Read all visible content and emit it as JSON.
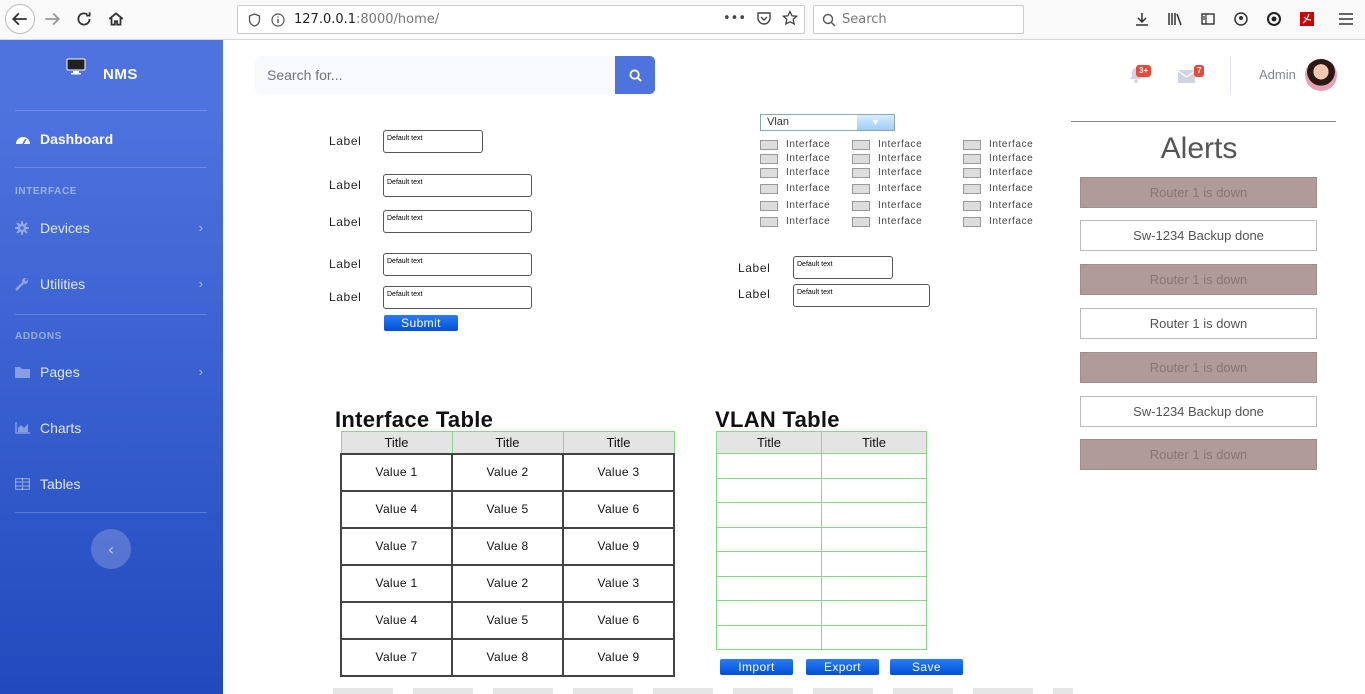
{
  "browser": {
    "url_host": "127.0.0.1",
    "url_rest": ":8000/home/",
    "url_more": "•••",
    "search_placeholder": "Search"
  },
  "sidebar": {
    "brand": "NMS",
    "dashboard": "Dashboard",
    "heading_interface": "INTERFACE",
    "devices": "Devices",
    "utilities": "Utilities",
    "heading_addons": "ADDONS",
    "pages": "Pages",
    "charts": "Charts",
    "tables": "Tables"
  },
  "topbar": {
    "search_placeholder": "Search for...",
    "alerts_count": "3+",
    "messages_count": "7",
    "user_name": "Admin"
  },
  "form_left": {
    "labels": [
      "Label",
      "Label",
      "Label",
      "Label",
      "Label"
    ],
    "values": [
      "Default text",
      "Default text",
      "Default text",
      "Default text",
      "Default text"
    ],
    "submit": "Submit"
  },
  "form_right": {
    "vlan_select": "Vlan",
    "interface_label": "Interface",
    "labels": [
      "Label",
      "Label"
    ],
    "values": [
      "Default text",
      "Default text"
    ]
  },
  "interface_table": {
    "title": "Interface Table",
    "headers": [
      "Title",
      "Title",
      "Title"
    ],
    "rows": [
      [
        "Value 1",
        "Value 2",
        "Value 3"
      ],
      [
        "Value 4",
        "Value 5",
        "Value 6"
      ],
      [
        "Value 7",
        "Value 8",
        "Value 9"
      ],
      [
        "Value 1",
        "Value 2",
        "Value 3"
      ],
      [
        "Value 4",
        "Value 5",
        "Value 6"
      ],
      [
        "Value 7",
        "Value 8",
        "Value 9"
      ]
    ]
  },
  "vlan_table": {
    "title": "VLAN Table",
    "headers": [
      "Title",
      "Title"
    ],
    "import": "Import",
    "export": "Export",
    "save": "Save"
  },
  "alerts": {
    "title": "Alerts",
    "items": [
      {
        "text": "Router 1 is down",
        "status": "down"
      },
      {
        "text": "Sw-1234 Backup done",
        "status": "ok"
      },
      {
        "text": "Router 1 is down",
        "status": "down"
      },
      {
        "text": "Router 1 is down",
        "status": "ok"
      },
      {
        "text": "Router 1 is down",
        "status": "down"
      },
      {
        "text": "Sw-1234 Backup done",
        "status": "ok"
      },
      {
        "text": "Router 1 is down",
        "status": "down"
      }
    ]
  },
  "colors": {
    "primary": "#4e73df",
    "primary_dark": "#224abe",
    "danger": "#e74a3b",
    "alert_down": "#b09a9a"
  }
}
